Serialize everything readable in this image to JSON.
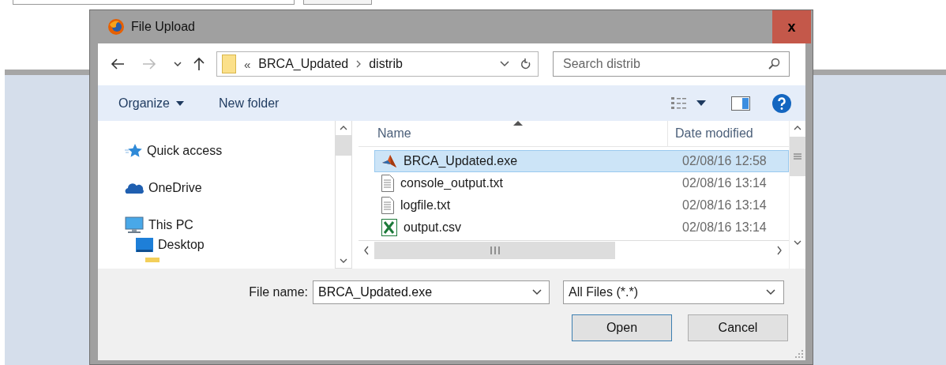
{
  "window": {
    "title": "File Upload",
    "close": "x"
  },
  "navigation": {
    "overflow": "«",
    "path": [
      "BRCA_Updated",
      "distrib"
    ],
    "search": {
      "placeholder": "Search distrib"
    }
  },
  "toolbar": {
    "organize": "Organize",
    "new_folder": "New folder"
  },
  "sidebar": {
    "items": [
      {
        "label": "Quick access",
        "kind": "star"
      },
      {
        "label": "OneDrive",
        "kind": "cloud"
      },
      {
        "label": "This PC",
        "kind": "computer",
        "children": [
          {
            "label": "Desktop",
            "kind": "desktop"
          }
        ]
      }
    ]
  },
  "table": {
    "columns": [
      {
        "label": "Name",
        "sorted": true
      },
      {
        "label": "Date modified",
        "sorted": false
      }
    ],
    "rows": [
      {
        "name": "BRCA_Updated.exe",
        "date": "02/08/16 12:58",
        "kind": "exe",
        "selected": true
      },
      {
        "name": "console_output.txt",
        "date": "02/08/16 13:14",
        "kind": "txt",
        "selected": false
      },
      {
        "name": "logfile.txt",
        "date": "02/08/16 13:14",
        "kind": "txt",
        "selected": false
      },
      {
        "name": "output.csv",
        "date": "02/08/16 13:14",
        "kind": "csv",
        "selected": false
      }
    ]
  },
  "footer": {
    "file_name_label": "File name:",
    "file_name": "BRCA_Updated.exe",
    "filter": "All Files (*.*)",
    "buttons": [
      {
        "label": "Open",
        "default": true
      },
      {
        "label": "Cancel",
        "default": false
      }
    ]
  }
}
